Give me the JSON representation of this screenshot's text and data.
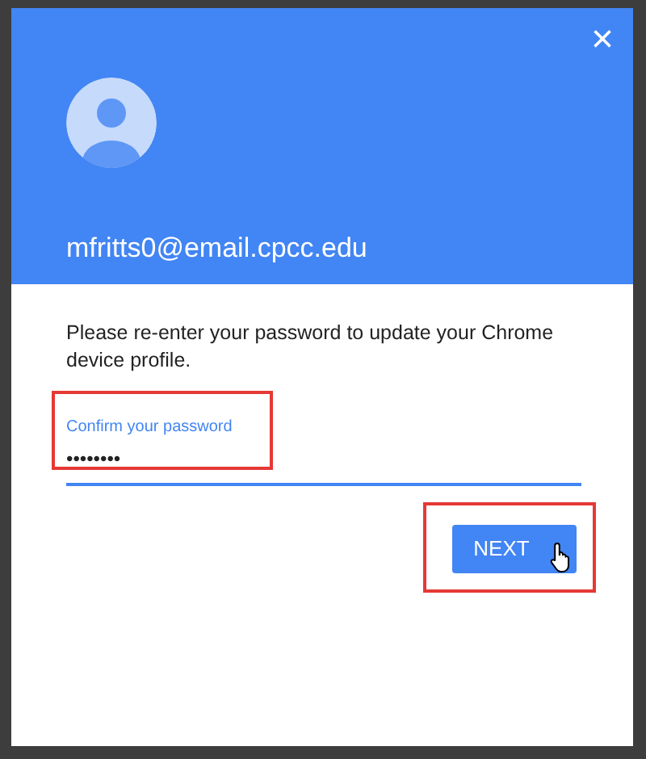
{
  "dialog": {
    "close_label": "×",
    "email": "mfritts0@email.cpcc.edu",
    "message": "Please re-enter your password to update your Chrome device profile.",
    "password_field": {
      "label": "Confirm your password",
      "value": "••••••••",
      "highlighted": true
    },
    "next_button": {
      "label": "NEXT",
      "highlighted": true
    }
  }
}
